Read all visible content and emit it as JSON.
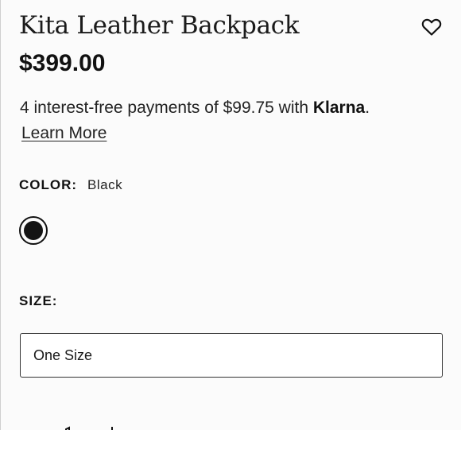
{
  "product": {
    "title": "Kita Leather Backpack",
    "price": "$399.00",
    "wishlist_icon": "heart-outline-icon"
  },
  "payment": {
    "text": "4 interest-free payments of $99.75 with ",
    "brand": "Klarna",
    "suffix": ".",
    "learn_more": "Learn More"
  },
  "color": {
    "label": "COLOR:",
    "value": "Black",
    "swatches": [
      {
        "name": "Black",
        "hex": "#141414",
        "selected": true
      }
    ]
  },
  "size": {
    "label": "SIZE:",
    "selected": "One Size"
  },
  "colors": {
    "text": "#111111",
    "background": "#fbfbfb",
    "border": "#333333"
  }
}
